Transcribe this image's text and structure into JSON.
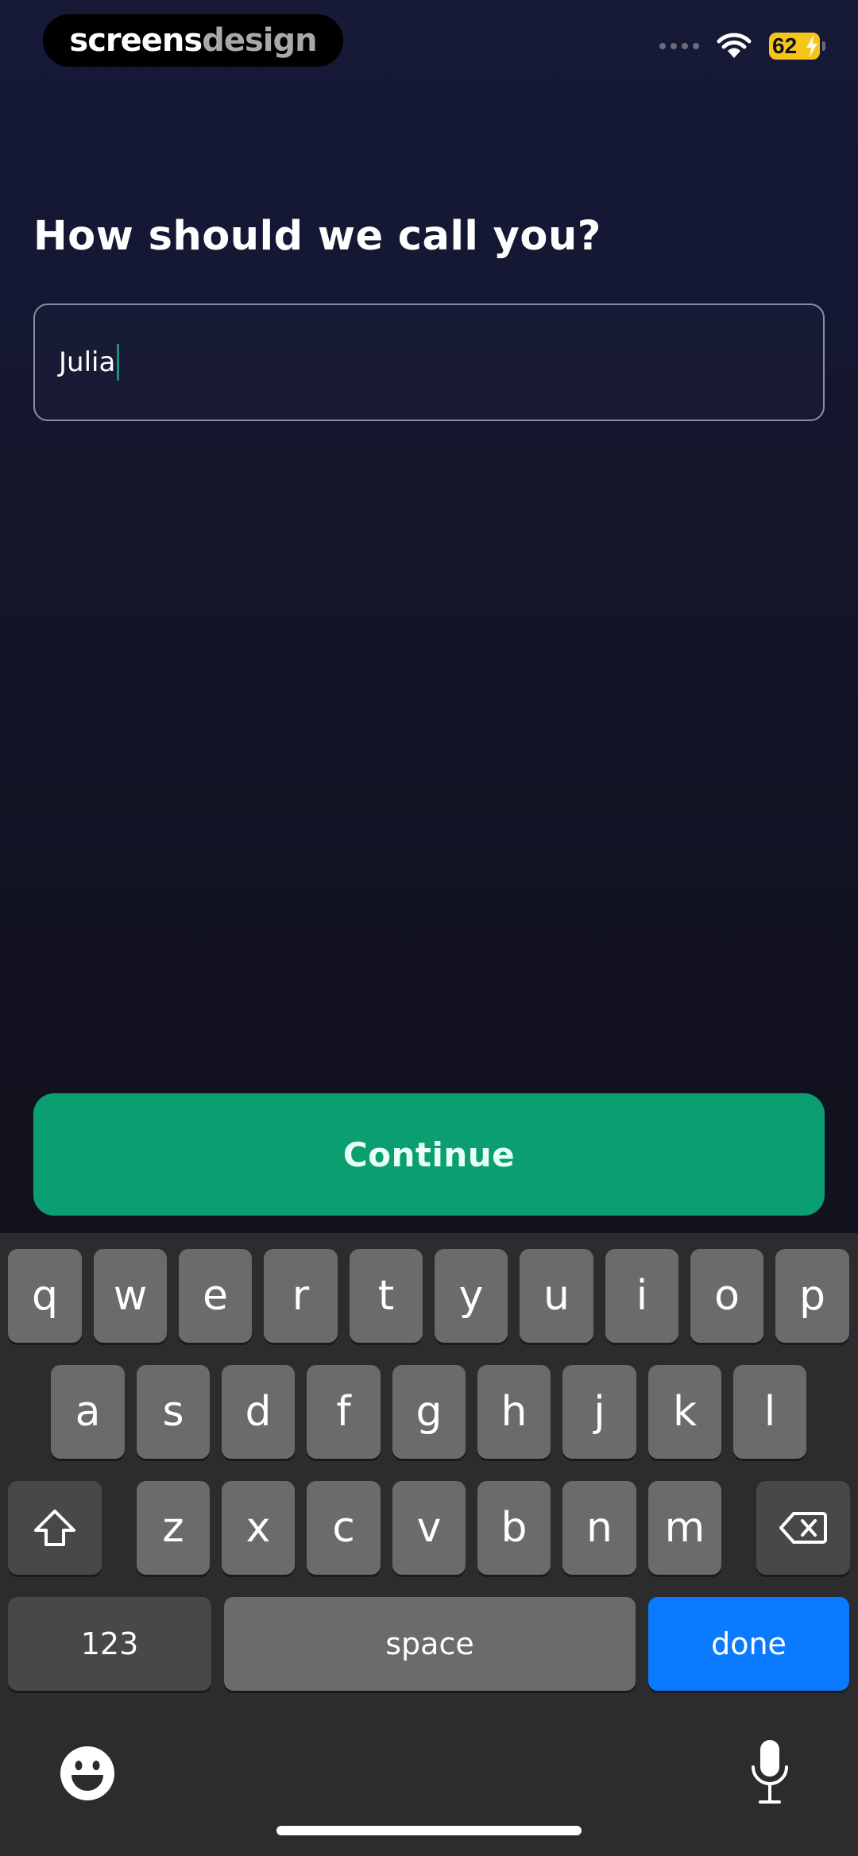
{
  "status_bar": {
    "brand_part1": "screens",
    "brand_part2": "design",
    "battery_level": "62"
  },
  "main": {
    "title": "How should we call you?",
    "name_field_value": "Julia",
    "continue_label": "Continue"
  },
  "keyboard": {
    "row1": [
      "q",
      "w",
      "e",
      "r",
      "t",
      "y",
      "u",
      "i",
      "o",
      "p"
    ],
    "row2": [
      "a",
      "s",
      "d",
      "f",
      "g",
      "h",
      "j",
      "k",
      "l"
    ],
    "row3": [
      "z",
      "x",
      "c",
      "v",
      "b",
      "n",
      "m"
    ],
    "numbers_label": "123",
    "space_label": "space",
    "done_label": "done"
  },
  "colors": {
    "accent_green": "#0a9e70",
    "done_blue": "#0a7aff",
    "battery_yellow": "#f5c518"
  }
}
